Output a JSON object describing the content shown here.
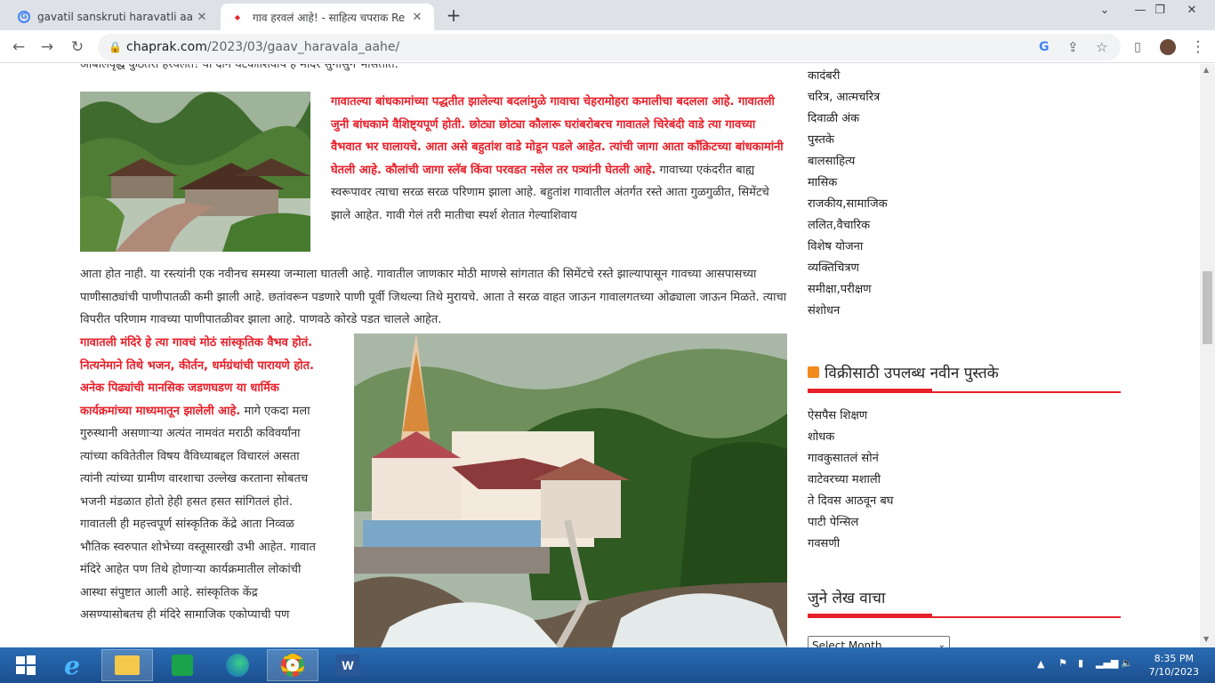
{
  "tabs": [
    {
      "title": "gavatil sanskruti haravatli aahe in",
      "icon": "google-g-icon"
    },
    {
      "title": "गाव हरवलं आहे! - साहित्य चपराक Re",
      "icon": "chaprak-favicon-icon"
    }
  ],
  "url": {
    "host": "chaprak.com",
    "path": "/2023/03/gaav_haravala_aahe/"
  },
  "article": {
    "p0": "आबालवृद्ध कुठेतरी हरवलेत! या दोन घटकांशिवाय हे मंदिर सुनासुनं भासतात.",
    "p1_red": "गावातल्या बांधकामांच्या पद्धतीत झालेल्या बदलांमुळे गावाचा चेहरामोहरा कमालीचा बदलला आहे. गावातली जुनी बांधकामे वैशिष्ट्यपूर्ण होती. छोट्या छोट्या कौलारू घरांबरोबरच गावातले चिरेबंदी वाडे त्या गावच्या वैभवात भर घालायचे. आता असे बहुतांश वाडे मोडून पडले आहेत. त्यांची जागा आता कॉंक्रिटच्या बांधकामांनी घेतली आहे. कौलांची जागा स्लॅब किंवा परवडत नसेल तर पत्र्यांनी घेतली आहे.",
    "p1_rest": " गावाच्या एकंदरीत बाह्य स्वरूपावर त्याचा सरळ सरळ परिणाम झाला आहे. बहुतांश गावातील अंतर्गत रस्ते आता गुळगुळीत, सिमेंटचे झाले आहेत. गावी गेलं तरी मातीचा स्पर्श शेतात गेल्याशिवाय",
    "p2": "आता होत नाही. या रस्त्यांनी एक नवीनच समस्या जन्माला घातली आहे. गावातील जाणकार मोठी माणसे सांगतात की सिमेंटचे रस्ते झाल्यापासून गावच्या आसपासच्या पाणीसाठ्यांची पाणीपातळी कमी झाली आहे. छतांवरून पडणारे पाणी पूर्वी जिथल्या तिथे मुरायचे. आता ते सरळ वाहत जाऊन गावालगतच्या ओढ्याला जाऊन मिळते. त्याचा विपरीत परिणाम गावच्या पाणीपातळीवर झाला आहे. पाणवठे कोरडे पडत चालले आहेत.",
    "p3_red": "गावातली मंदिरे हे त्या गावचं मोठं सांस्कृतिक वैभव होतं. नित्यनेमाने तिथे भजन, कीर्तन, धर्मग्रंथांची पारायणे होत. अनेक पिढ्यांची मानसिक जडणघडण या धार्मिक कार्यक्रमांच्या माध्यमातून झालेली आहे.",
    "p3_rest": " मागे एकदा मला गुरुस्थानी असणाऱ्या अत्यंत नामवंत मराठी कविवर्यांना त्यांच्या कवितेतील विषय वैविध्याबद्दल विचारलं असता त्यांनी त्यांच्या ग्रामीण वारशाचा उल्लेख करताना सोबतच भजनी मंडळात होतो हेही हसत हसत सांगितलं होतं. गावातली ही महत्त्वपूर्ण सांस्कृतिक केंद्रे आता निव्वळ भौतिक स्वरुपात शोभेच्या वस्तूसारखी उभी आहेत. गावात मंदिरे आहेत पण तिथे होणाऱ्या कार्यक्रमातील लोकांची आस्था संपुष्टात आली आहे. सांस्कृतिक केंद्र असण्यासोबतच ही मंदिरे सामाजिक एकोप्याची पण"
  },
  "sidebar": {
    "categories": [
      "कादंबरी",
      "चरित्र, आत्मचरित्र",
      "दिवाळी अंक",
      "पुस्तके",
      "बालसाहित्य",
      "मासिक",
      "राजकीय,सामाजिक",
      "ललित,वैचारिक",
      "विशेष योजना",
      "व्यक्तिचित्रण",
      "समीक्षा,परीक्षण",
      "संशोधन"
    ],
    "books_title": "विक्रीसाठी उपलब्ध नवीन पुस्तके",
    "books": [
      "ऐसपैस शिक्षण",
      "शोधक",
      "गावकुसातलं सोनं",
      "वाटेवरच्या मशाली",
      "ते दिवस आठवून बघ",
      "पाटी पेन्सिल",
      "गवसणी"
    ],
    "archive_title": "जुने लेख वाचा",
    "select_month": "Select Month"
  },
  "clock": {
    "time": "8:35 PM",
    "date": "7/10/2023"
  },
  "colors": {
    "accent": "#e8202a",
    "taskbar": "#1b4f8f"
  }
}
